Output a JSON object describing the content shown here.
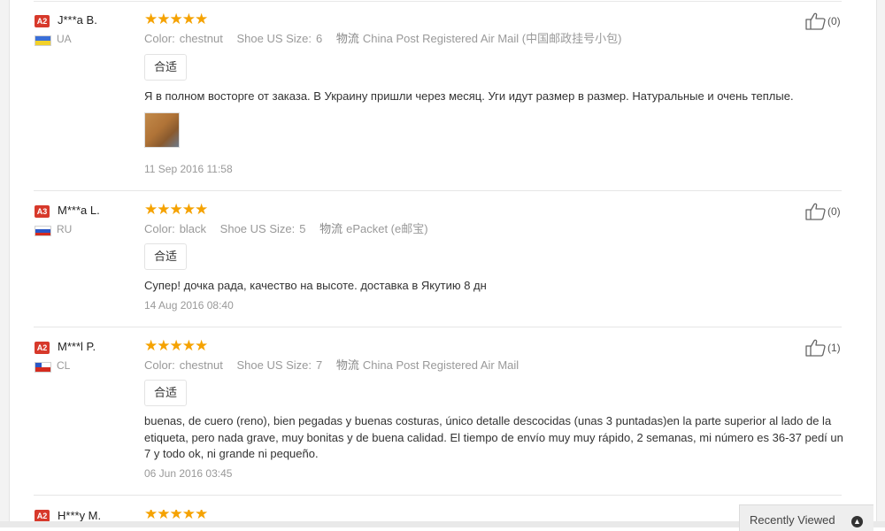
{
  "labels": {
    "color": "Color:",
    "size": "Shoe US Size:",
    "shipping": "物流"
  },
  "reviews": [
    {
      "badge": "A2",
      "user": "J***a B.",
      "country": "UA",
      "flag_colors": [
        "#3a6fd8",
        "#f2d12a"
      ],
      "rating": 5,
      "stars": "★★★★★",
      "color": "chestnut",
      "size": "6",
      "shipping": "China Post Registered Air Mail (中国邮政挂号小包)",
      "fit": "合适",
      "text": "Я в полном восторге от заказа. В Украину пришли через месяц. Уги идут размер в размер. Натуральные и очень теплые.",
      "has_photo": true,
      "date": "11 Sep 2016 11:58",
      "helpful": "(0)"
    },
    {
      "badge": "A3",
      "user": "M***a L.",
      "country": "RU",
      "flag_colors": [
        "#ffffff",
        "#2a56c6",
        "#d52b1e"
      ],
      "rating": 5,
      "stars": "★★★★★",
      "color": "black",
      "size": "5",
      "shipping": "ePacket (e邮宝)",
      "fit": "合适",
      "text": "Супер! дочка рада, качество на высоте. доставка в Якутию 8 дн",
      "has_photo": false,
      "date": "14 Aug 2016 08:40",
      "helpful": "(0)"
    },
    {
      "badge": "A2",
      "user": "M***l P.",
      "country": "CL",
      "flag_colors": [
        "#ffffff",
        "#d52b1e"
      ],
      "rating": 5,
      "stars": "★★★★★",
      "color": "chestnut",
      "size": "7",
      "shipping": "China Post Registered Air Mail",
      "fit": "合适",
      "text": "buenas, de cuero (reno), bien pegadas y buenas costuras, único detalle descocidas (unas 3 puntadas)en la parte superior al lado de la etiqueta, pero nada grave, muy bonitas y de buena calidad. El tiempo de envío muy muy rápido, 2 semanas, mi número es 36-37 pedí un 7 y todo ok, ni grande ni pequeño.",
      "has_photo": false,
      "date": "06 Jun 2016 03:45",
      "helpful": "(1)"
    },
    {
      "badge": "A2",
      "user": "H***y M.",
      "rating": 5,
      "stars": "★★★★★"
    }
  ],
  "recently_viewed": "Recently Viewed",
  "recently_viewed_icon": "chevron-up-icon"
}
